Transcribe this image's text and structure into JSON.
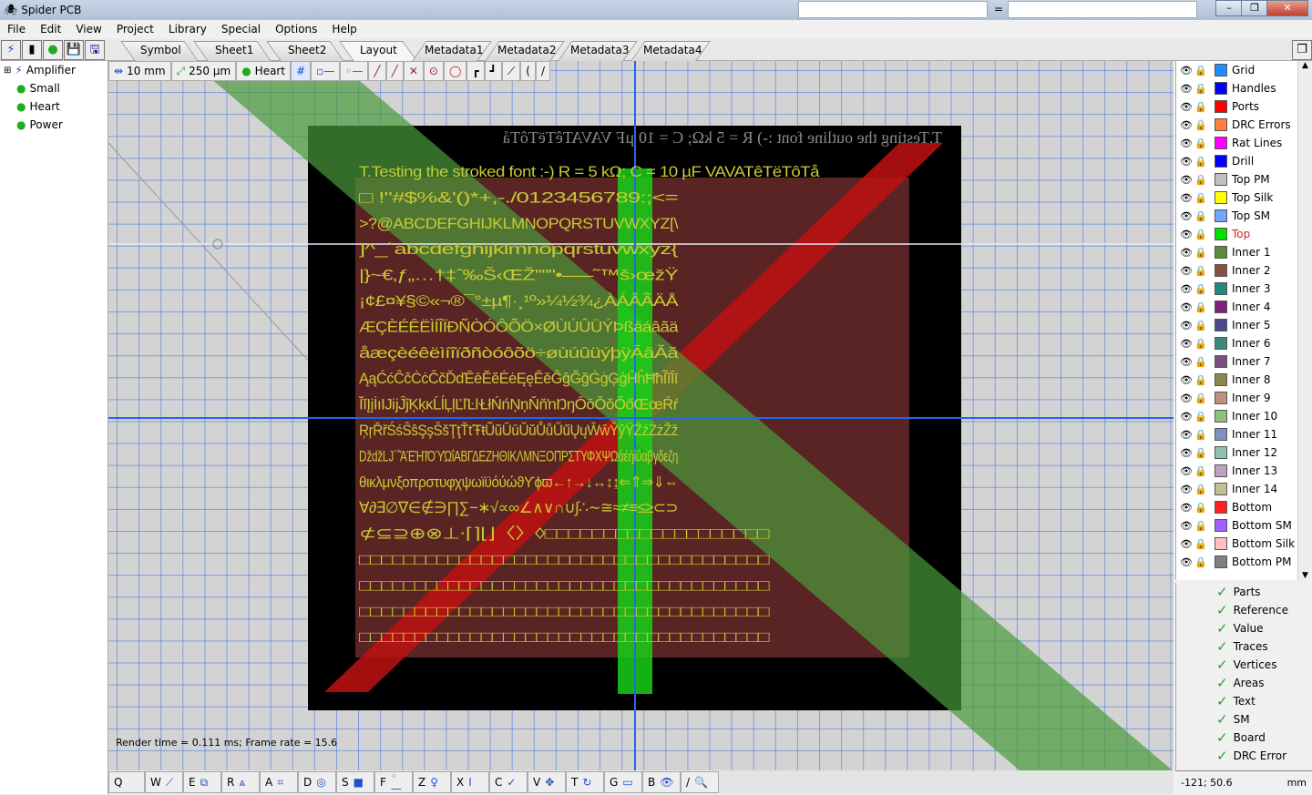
{
  "window": {
    "title": "Spider PCB",
    "buttons": [
      "–",
      "❐",
      "✕"
    ],
    "equals": "="
  },
  "menu": [
    "File",
    "Edit",
    "View",
    "Project",
    "Library",
    "Special",
    "Options",
    "Help"
  ],
  "tabs": [
    "Symbol",
    "Sheet1",
    "Sheet2",
    "Layout",
    "Metadata1",
    "Metadata2",
    "Metadata3",
    "Metadata4"
  ],
  "active_tab": "Layout",
  "tree": {
    "root": "Amplifier",
    "children": [
      "Small",
      "Heart",
      "Power"
    ]
  },
  "toolbar": {
    "grid": "10 mm",
    "width": "250 µm",
    "part": "Heart"
  },
  "layers": [
    {
      "name": "Grid",
      "color": "#1e8fff"
    },
    {
      "name": "Handles",
      "color": "#0000ff"
    },
    {
      "name": "Ports",
      "color": "#ff0000"
    },
    {
      "name": "DRC Errors",
      "color": "#ff8040"
    },
    {
      "name": "Rat Lines",
      "color": "#ff00ff"
    },
    {
      "name": "Drill",
      "color": "#0000ff"
    },
    {
      "name": "Top PM",
      "color": "#c0c0c0"
    },
    {
      "name": "Top Silk",
      "color": "#ffff00"
    },
    {
      "name": "Top SM",
      "color": "#6ea8ff"
    },
    {
      "name": "Top",
      "color": "#00e000",
      "active": true
    },
    {
      "name": "Inner 1",
      "color": "#5a8a3a"
    },
    {
      "name": "Inner 2",
      "color": "#8a5040"
    },
    {
      "name": "Inner 3",
      "color": "#208a80"
    },
    {
      "name": "Inner 4",
      "color": "#801e80"
    },
    {
      "name": "Inner 5",
      "color": "#4a4a8a"
    },
    {
      "name": "Inner 6",
      "color": "#3a8a7a"
    },
    {
      "name": "Inner 7",
      "color": "#7a5080"
    },
    {
      "name": "Inner 8",
      "color": "#8a8a50"
    },
    {
      "name": "Inner 9",
      "color": "#c09080"
    },
    {
      "name": "Inner 10",
      "color": "#90c080"
    },
    {
      "name": "Inner 11",
      "color": "#8090c0"
    },
    {
      "name": "Inner 12",
      "color": "#90c0b0"
    },
    {
      "name": "Inner 13",
      "color": "#c0a0c0"
    },
    {
      "name": "Inner 14",
      "color": "#c0c090"
    },
    {
      "name": "Bottom",
      "color": "#ff2020"
    },
    {
      "name": "Bottom SM",
      "color": "#a060ff"
    },
    {
      "name": "Bottom Silk",
      "color": "#ffc0c0"
    },
    {
      "name": "Bottom PM",
      "color": "#808080"
    }
  ],
  "visibility": [
    "Parts",
    "Reference",
    "Value",
    "Traces",
    "Vertices",
    "Areas",
    "Text",
    "SM",
    "Board",
    "DRC Error"
  ],
  "status": {
    "coords": "-121; 50.6",
    "units": "mm",
    "render": "Render time = 0.111 ms; Frame rate = 15.6"
  },
  "shortcuts": [
    "Q",
    "W",
    "E",
    "R",
    "A",
    "D",
    "S",
    "F",
    "Z",
    "X",
    "C",
    "V",
    "T",
    "G",
    "B",
    "/"
  ],
  "pcb_text": {
    "outline": "T.Testing the outline font :-) R = 5 kΩ; C = 10 µF VAVATêTëTôTå",
    "lines": [
      "T.Testing the stroked font :-) R = 5 kΩ; C = 10 µF VAVATêTëTôTå",
      "□ !\"#$%&'()*+,-./0123456789:;<=",
      ">?@ABCDEFGHIJKLMNOPQRSTUVWXYZ[\\",
      "]^_`abcdefghijklmnopqrstuvwxyz{",
      "|}~€‚ƒ„…†‡ˆ‰Š‹ŒŽ''\"\"•–—˜™š›œžŸ",
      "¡¢£¤¥§©«¬®¯°±µ¶·¸¹º»¼½¾¿ÀÁÂÃÄÅ",
      "ÆÇÈÉÊËÌÍÎÏÐÑÒÓÔÕÖ×ØÙÚÛÜÝÞßàáâãä",
      "åæçèéêëìíîïðñòóôõö÷øùúûüýþÿĀāĂă",
      "ĄąĆćĈĉĊċČčĎďĒēĔĕĖėĘęĚěĜĝĞğĠġĢģĤĥĦħĨĩĪī",
      "ĬĭĮįİıĲĳĴĵĶķĸĹĺĻļĽľĿŀŁłŃńŅņŇňŉŊŋŌōŎŏŐőŒœŔŕ",
      "ŖŗŘřŚśŜŝŞşŠšŢţŤťŦŧŨũŪūŬŭŮůŰűŲųŴŵŶŷŸŹźŻżŽž",
      "ǅǆǇ΄΅ΆΈΉΊΌΎΏΐΑΒΓΔΕΖΗΘΙΚΛΜΝΞΟΠΡΣΤΥΦΧΨΩάέήίΰαβγδεζη",
      "θικλμνξοπρστυφχψωϊϋόύώϑϒϕϖ←↑→↓↔↕↨⇐⇑⇒⇓⇔",
      "∀∂∃∅∇∈∉∋∏∑−∗√∝∞∠∧∨∩∪∫∴∼≅≈≠≡≤≥⊂⊃",
      "⊄⊆⊇⊕⊗⊥⋅⌈⌉⌊⌋〈〉◊□□□□□□□□□□□□□□□□□□□",
      "□□□□□□□□□□□□□□□□□□□□□□□□□□□□□□□□□□□□□",
      "□□□□□□□□□□□□□□□□□□□□□□□□□□□□□□□□□□□□□",
      "□□□□□□□□□□□□□□□□□□□□□□□□□□□□□□□□□□□□□",
      "□□□□□□□□□□□□□□□□□□□□□□□□□□□□□□□□□□□□□"
    ]
  }
}
